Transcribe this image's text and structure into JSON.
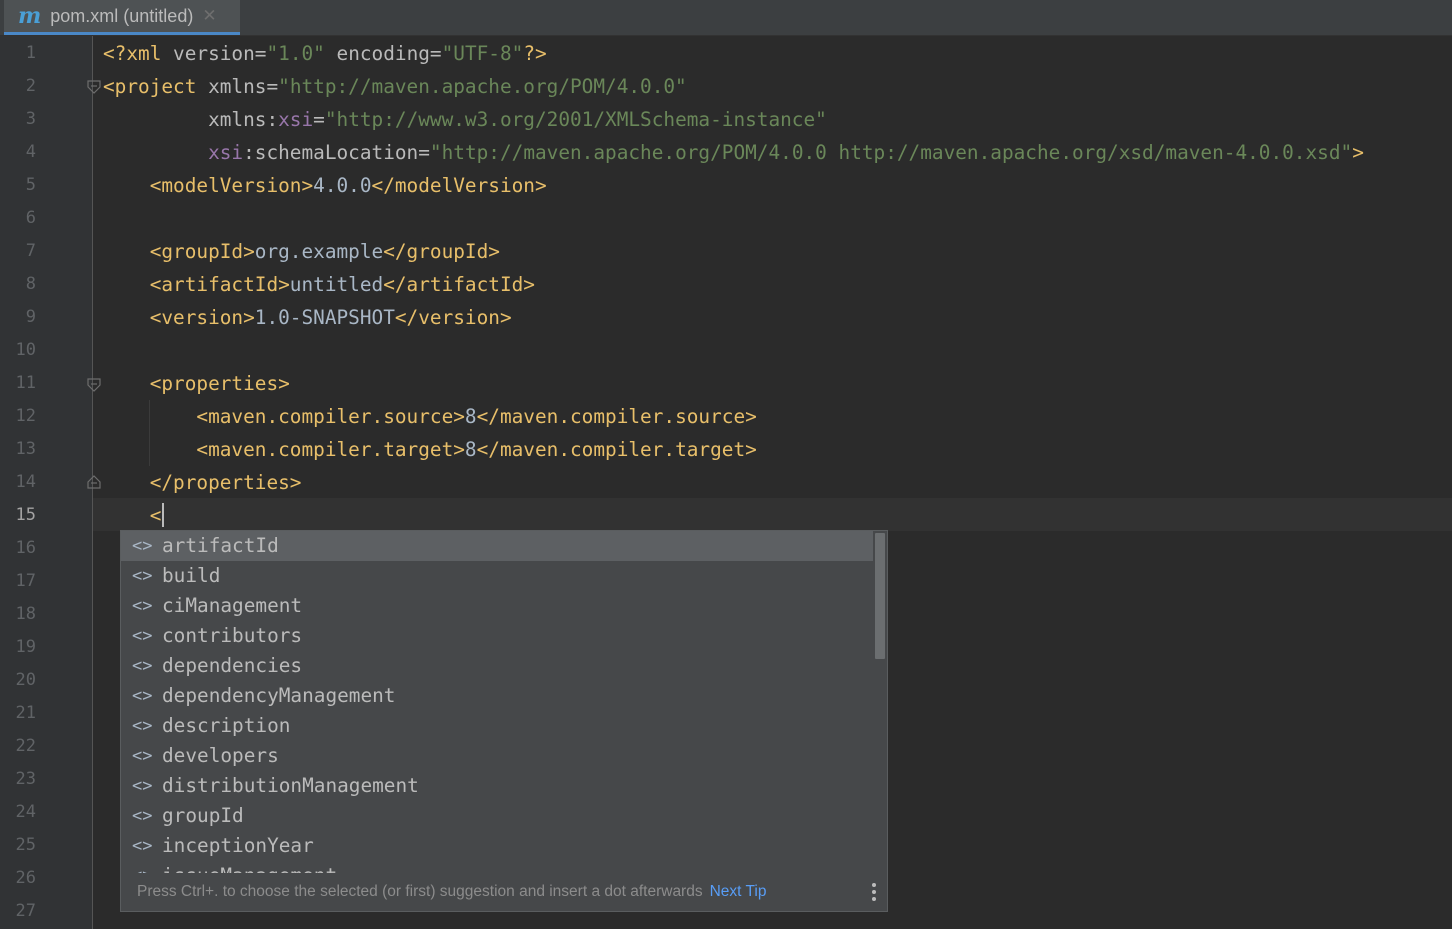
{
  "tab": {
    "icon": "maven-m-icon",
    "icon_glyph": "m",
    "label": "pom.xml (untitled)",
    "close_glyph": "✕"
  },
  "gutter": {
    "line_numbers": [
      "1",
      "2",
      "3",
      "4",
      "5",
      "6",
      "7",
      "8",
      "9",
      "10",
      "11",
      "12",
      "13",
      "14",
      "15",
      "16",
      "17",
      "18",
      "19",
      "20",
      "21",
      "22",
      "23",
      "24",
      "25",
      "26",
      "27"
    ],
    "current_line": "15"
  },
  "code": {
    "l1": {
      "a": "<?xml ",
      "b": "version",
      "c": "=",
      "d": "\"1.0\"",
      "e": " encoding",
      "f": "=",
      "g": "\"UTF-8\"",
      "h": "?>"
    },
    "l2": {
      "a": "<project ",
      "b": "xmlns",
      "c": "=",
      "d": "\"http://maven.apache.org/POM/4.0.0\""
    },
    "l3": {
      "indent": "         ",
      "a": "xmlns:",
      "b": "xsi",
      "c": "=",
      "d": "\"http://www.w3.org/2001/XMLSchema-instance\""
    },
    "l4": {
      "indent": "         ",
      "a": "xsi",
      "b": ":schemaLocation",
      "c": "=",
      "d": "\"http://maven.apache.org/POM/4.0.0 http://maven.apache.org/xsd/maven-4.0.0.xsd\"",
      "e": ">"
    },
    "l5": {
      "indent": "    ",
      "open": "<modelVersion>",
      "text": "4.0.0",
      "close": "</modelVersion>"
    },
    "l7": {
      "indent": "    ",
      "open": "<groupId>",
      "text": "org.example",
      "close": "</groupId>"
    },
    "l8": {
      "indent": "    ",
      "open": "<artifactId>",
      "text": "untitled",
      "close": "</artifactId>"
    },
    "l9": {
      "indent": "    ",
      "open": "<version>",
      "text": "1.0-SNAPSHOT",
      "close": "</version>"
    },
    "l11": {
      "indent": "    ",
      "open": "<properties>"
    },
    "l12": {
      "indent": "        ",
      "open": "<maven.compiler.source>",
      "text": "8",
      "close": "</maven.compiler.source>"
    },
    "l13": {
      "indent": "        ",
      "open": "<maven.compiler.target>",
      "text": "8",
      "close": "</maven.compiler.target>"
    },
    "l14": {
      "indent": "    ",
      "close": "</properties>"
    },
    "l15": {
      "indent": "    ",
      "typed": "<"
    }
  },
  "completion": {
    "item_icon": "xml-tag-icon",
    "item_icon_glyph": "<>",
    "items": [
      "artifactId",
      "build",
      "ciManagement",
      "contributors",
      "dependencies",
      "dependencyManagement",
      "description",
      "developers",
      "distributionManagement",
      "groupId",
      "inceptionYear",
      "issueManagement"
    ],
    "selected_index": 0,
    "footer_text": "Press Ctrl+. to choose the selected (or first) suggestion and insert a dot afterwards",
    "next_tip_label": "Next Tip"
  },
  "colors": {
    "tag": "#e8bf6a",
    "value": "#6a8759",
    "namespace": "#9876aa",
    "text": "#a9b7c6",
    "link": "#589df6"
  }
}
